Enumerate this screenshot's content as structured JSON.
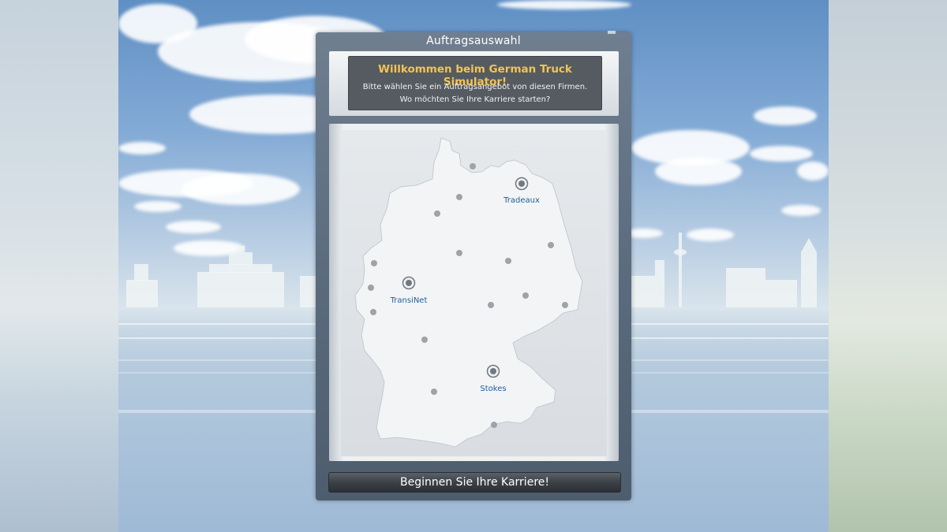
{
  "window": {
    "title": "Auftragsauswahl"
  },
  "welcome": {
    "title": "Willkommen beim German Truck Simulator!",
    "line1": "Bitte wählen Sie ein Auftragsangebot von diesen Firmen.",
    "line2": "Wo möchten Sie Ihre Karriere starten?"
  },
  "map": {
    "companies": [
      {
        "name": "Tradeaux",
        "icon": "company-marker-icon"
      },
      {
        "name": "TransiNet",
        "icon": "company-marker-icon"
      },
      {
        "name": "Stokes",
        "icon": "company-marker-icon"
      }
    ],
    "city_dot_icon": "city-dot-icon"
  },
  "actions": {
    "start_label": "Beginnen Sie Ihre Karriere!"
  },
  "colors": {
    "welcome_title": "#f3c450",
    "company_label": "#1e5e9a",
    "map_land": "#f3f4f6",
    "panel": "#5b6c7e"
  }
}
